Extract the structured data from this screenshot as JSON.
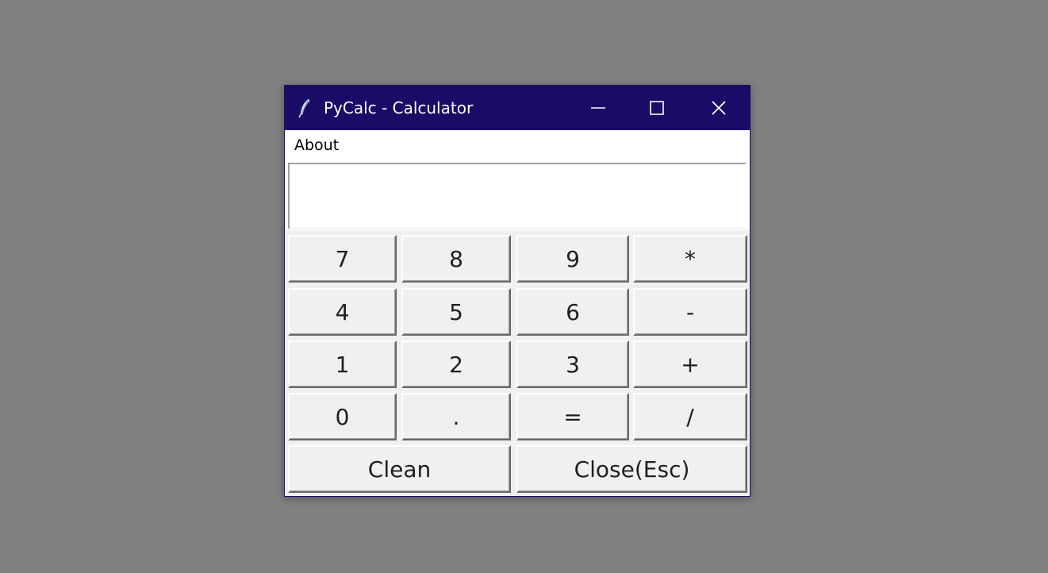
{
  "window": {
    "title": "PyCalc - Calculator",
    "titlebar_color": "#1a0b66",
    "icon": "feather-icon",
    "controls": [
      "minimize-icon",
      "maximize-icon",
      "close-icon"
    ]
  },
  "menu": {
    "about_label": "About"
  },
  "display": {
    "value": ""
  },
  "keys": {
    "k7": "7",
    "k8": "8",
    "k9": "9",
    "mul": "*",
    "k4": "4",
    "k5": "5",
    "k6": "6",
    "sub": "-",
    "k1": "1",
    "k2": "2",
    "k3": "3",
    "add": "+",
    "k0": "0",
    "dot": ".",
    "eq": "=",
    "div": "/"
  },
  "actions": {
    "clean_label": "Clean",
    "close_label": "Close(Esc)"
  }
}
